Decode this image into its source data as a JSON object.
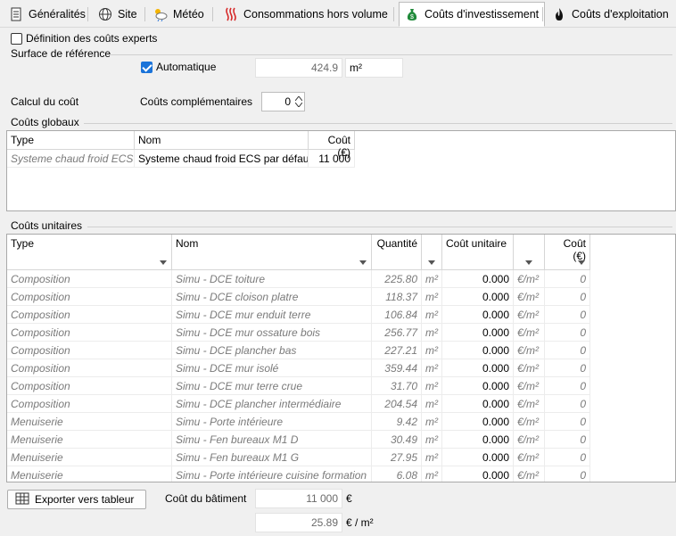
{
  "tabs": [
    {
      "label": "Généralités",
      "icon": "document-icon",
      "active": false
    },
    {
      "label": "Site",
      "icon": "globe-icon",
      "active": false
    },
    {
      "label": "Météo",
      "icon": "weather-icon",
      "active": false
    },
    {
      "label": "Consommations hors volume",
      "icon": "heat-icon",
      "active": false
    },
    {
      "label": "Coûts d'investissement",
      "icon": "money-bag-icon",
      "active": true
    },
    {
      "label": "Coûts d'exploitation",
      "icon": "flame-icon",
      "active": false
    }
  ],
  "expert_costs_label": "Définition des coûts experts",
  "surface": {
    "title": "Surface de référence",
    "auto_label": "Automatique",
    "value": "424.9",
    "unit": "m²"
  },
  "calc": {
    "label": "Calcul du coût",
    "complementary_label": "Coûts complémentaires",
    "complementary_value": "0"
  },
  "global_costs": {
    "title": "Coûts globaux",
    "headers": [
      "Type",
      "Nom",
      "Coût (€)"
    ],
    "rows": [
      {
        "type": "Systeme chaud froid ECS",
        "name": "Systeme chaud froid ECS par défaut",
        "cost": "11 000"
      }
    ]
  },
  "unit_costs": {
    "title": "Coûts unitaires",
    "headers": [
      "Type",
      "Nom",
      "Quantité",
      "",
      "Coût unitaire",
      "",
      "Coût (€)"
    ],
    "rows": [
      {
        "type": "Composition",
        "name": "Simu - DCE toiture",
        "qty": "225.80",
        "qty_unit": "m²",
        "unit_cost": "0.000",
        "cost_unit": "€/m²",
        "cost": "0"
      },
      {
        "type": "Composition",
        "name": "Simu - DCE cloison platre",
        "qty": "118.37",
        "qty_unit": "m²",
        "unit_cost": "0.000",
        "cost_unit": "€/m²",
        "cost": "0"
      },
      {
        "type": "Composition",
        "name": "Simu - DCE mur enduit terre",
        "qty": "106.84",
        "qty_unit": "m²",
        "unit_cost": "0.000",
        "cost_unit": "€/m²",
        "cost": "0"
      },
      {
        "type": "Composition",
        "name": "Simu - DCE mur ossature bois",
        "qty": "256.77",
        "qty_unit": "m²",
        "unit_cost": "0.000",
        "cost_unit": "€/m²",
        "cost": "0"
      },
      {
        "type": "Composition",
        "name": "Simu - DCE  plancher bas",
        "qty": "227.21",
        "qty_unit": "m²",
        "unit_cost": "0.000",
        "cost_unit": "€/m²",
        "cost": "0"
      },
      {
        "type": "Composition",
        "name": "Simu - DCE mur isolé",
        "qty": "359.44",
        "qty_unit": "m²",
        "unit_cost": "0.000",
        "cost_unit": "€/m²",
        "cost": "0"
      },
      {
        "type": "Composition",
        "name": "Simu - DCE mur terre crue",
        "qty": "31.70",
        "qty_unit": "m²",
        "unit_cost": "0.000",
        "cost_unit": "€/m²",
        "cost": "0"
      },
      {
        "type": "Composition",
        "name": "Simu - DCE plancher intermédiaire",
        "qty": "204.54",
        "qty_unit": "m²",
        "unit_cost": "0.000",
        "cost_unit": "€/m²",
        "cost": "0"
      },
      {
        "type": "Menuiserie",
        "name": "Simu - Porte intérieure",
        "qty": "9.42",
        "qty_unit": "m²",
        "unit_cost": "0.000",
        "cost_unit": "€/m²",
        "cost": "0"
      },
      {
        "type": "Menuiserie",
        "name": "Simu - Fen bureaux M1 D",
        "qty": "30.49",
        "qty_unit": "m²",
        "unit_cost": "0.000",
        "cost_unit": "€/m²",
        "cost": "0"
      },
      {
        "type": "Menuiserie",
        "name": "Simu - Fen bureaux M1 G",
        "qty": "27.95",
        "qty_unit": "m²",
        "unit_cost": "0.000",
        "cost_unit": "€/m²",
        "cost": "0"
      },
      {
        "type": "Menuiserie",
        "name": "Simu - Porte intérieure cuisine formation",
        "qty": "6.08",
        "qty_unit": "m²",
        "unit_cost": "0.000",
        "cost_unit": "€/m²",
        "cost": "0"
      }
    ]
  },
  "footer": {
    "export_label": "Exporter vers tableur",
    "building_cost_label": "Coût du bâtiment",
    "building_cost": "11 000",
    "building_cost_unit": "€",
    "cost_per_m2": "25.89",
    "cost_per_m2_unit": "€ / m²"
  },
  "colors": {
    "accent": "#1a73d9",
    "money_bag": "#1f8a3a",
    "heat": "#d62a2a"
  }
}
